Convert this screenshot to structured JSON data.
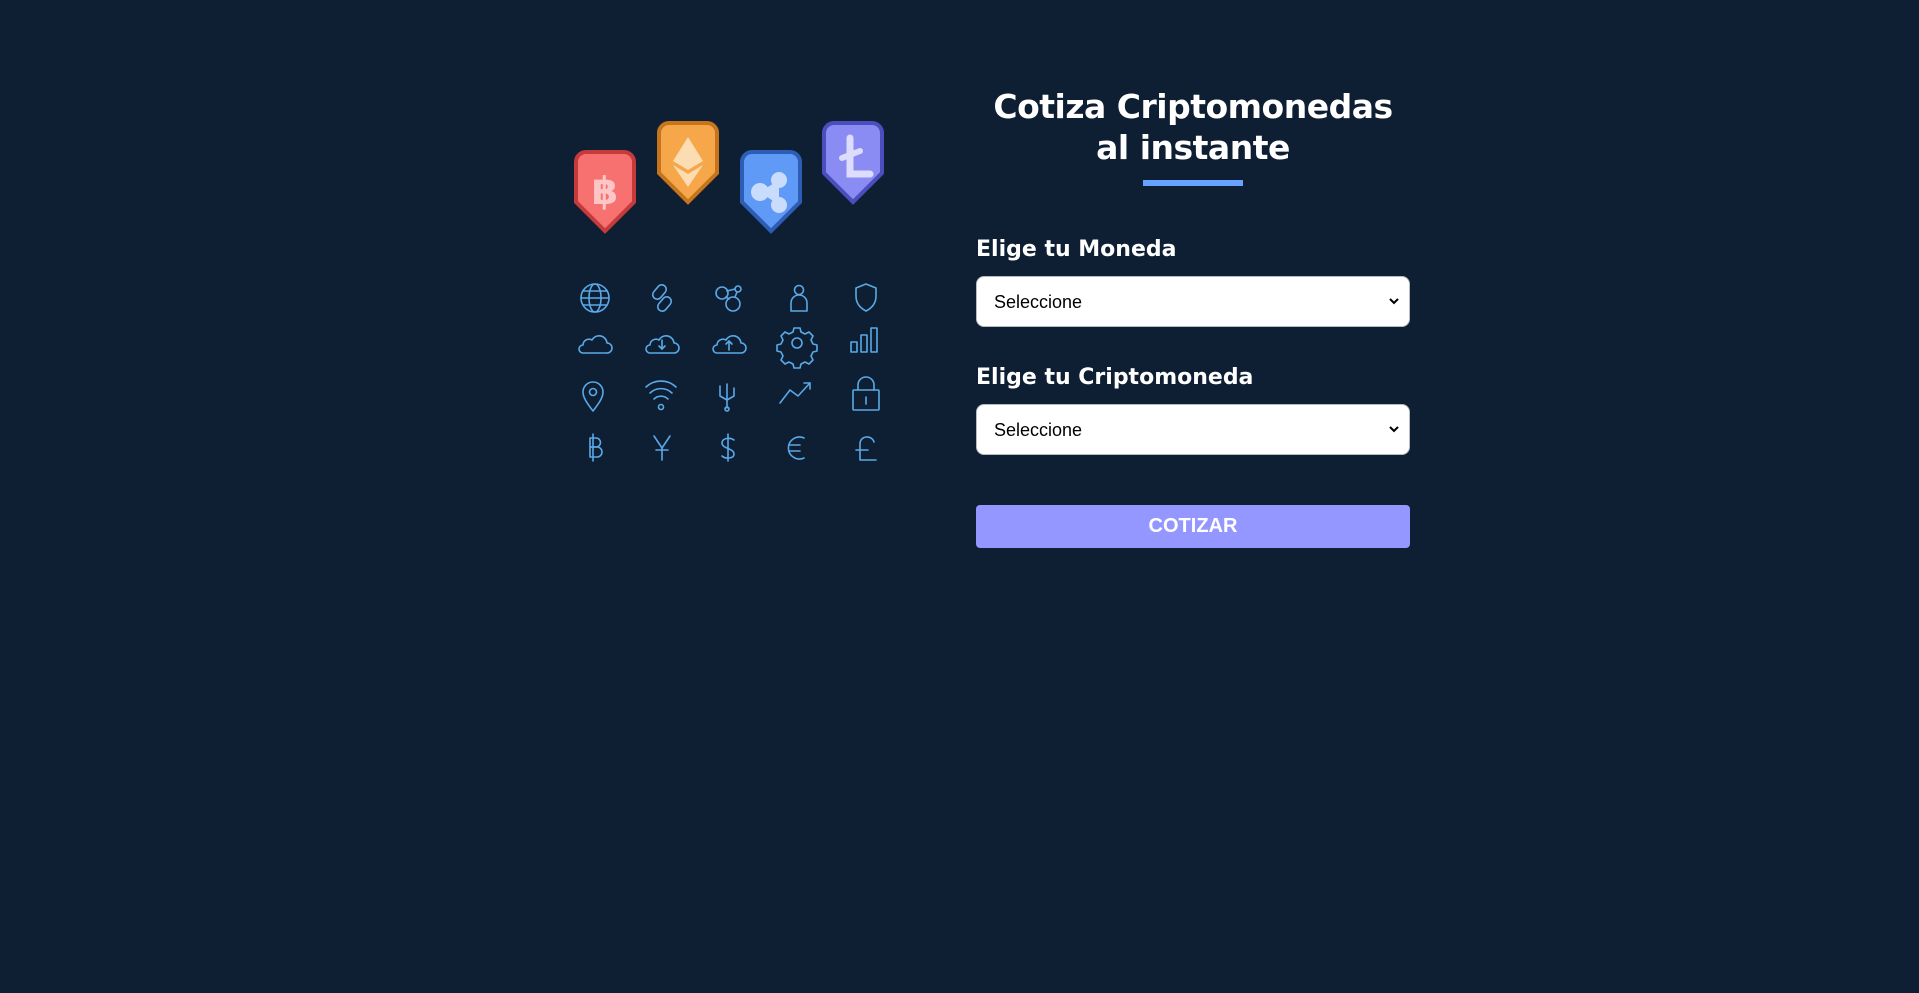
{
  "header": {
    "title": "Cotiza Criptomonedas al instante"
  },
  "form": {
    "currency": {
      "label": "Elige tu Moneda",
      "selected": "Seleccione"
    },
    "crypto": {
      "label": "Elige tu Criptomoneda",
      "selected": "Seleccione"
    },
    "submit_label": "COTIZAR"
  },
  "illustration": {
    "badges": [
      {
        "icon": "bitcoin-icon",
        "color": "#f87171",
        "border": "#c53b3b"
      },
      {
        "icon": "ethereum-icon",
        "color": "#f6a74a",
        "border": "#c7751c"
      },
      {
        "icon": "ripple-icon",
        "color": "#5f9af6",
        "border": "#2d5db4"
      },
      {
        "icon": "litecoin-icon",
        "color": "#8a8cf3",
        "border": "#4c4ebd"
      }
    ],
    "icon_grid": [
      [
        "globe-icon",
        "link-icon",
        "network-nodes-icon",
        "user-icon",
        "shield-icon"
      ],
      [
        "cloud-icon",
        "cloud-download-icon",
        "cloud-upload-icon",
        "gear-icon",
        "bar-chart-icon"
      ],
      [
        "location-pin-icon",
        "wifi-icon",
        "usb-connector-icon",
        "trend-up-icon",
        "lock-icon"
      ],
      [
        "bitcoin-symbol-icon",
        "yen-symbol-icon",
        "dollar-symbol-icon",
        "euro-symbol-icon",
        "pound-symbol-icon"
      ]
    ],
    "line_color": "#5aa9e6"
  },
  "colors": {
    "background": "#0e1f33",
    "accent": "#66a2fe",
    "button": "#9497ff"
  }
}
